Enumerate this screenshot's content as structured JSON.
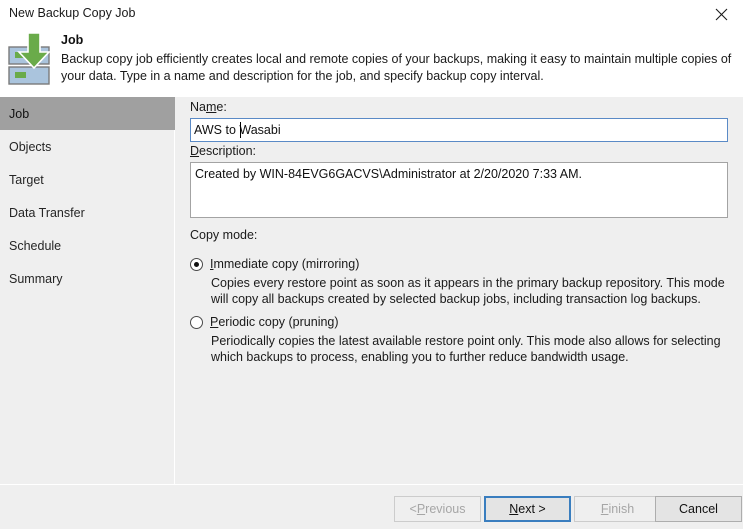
{
  "window": {
    "title": "New Backup Copy Job",
    "close_icon": "close-icon"
  },
  "header": {
    "icon": "backup-copy-job-icon",
    "title": "Job",
    "description": "Backup copy job efficiently creates local and remote copies of your backups, making it easy to maintain multiple copies of your data. Type in a name and description for the job, and specify backup copy interval."
  },
  "sidebar": {
    "items": [
      {
        "label": "Job",
        "selected": true
      },
      {
        "label": "Objects",
        "selected": false
      },
      {
        "label": "Target",
        "selected": false
      },
      {
        "label": "Data Transfer",
        "selected": false
      },
      {
        "label": "Schedule",
        "selected": false
      },
      {
        "label": "Summary",
        "selected": false
      }
    ]
  },
  "form": {
    "name_label_pre": "Na",
    "name_label_acc": "m",
    "name_label_post": "e:",
    "name_value": "AWS to Wasabi",
    "description_label_acc": "D",
    "description_label_post": "escription:",
    "description_value": "Created by WIN-84EVG6GACVS\\Administrator at 2/20/2020 7:33 AM.",
    "copy_mode_label": "Copy mode:",
    "copy_modes": [
      {
        "acc": "I",
        "label_rest": "mmediate copy (mirroring)",
        "selected": true,
        "description": "Copies every restore point as soon as it appears in the primary backup repository. This mode will copy all backups created by selected backup jobs, including transaction log backups."
      },
      {
        "acc": "P",
        "label_rest": "eriodic copy (pruning)",
        "selected": false,
        "description": "Periodically copies the latest available restore point only. This mode also allows for selecting which backups to process, enabling you to further reduce bandwidth usage."
      }
    ]
  },
  "footer": {
    "previous_pre": "< ",
    "previous_acc": "P",
    "previous_post": "revious",
    "next_acc": "N",
    "next_post": "ext >",
    "finish_acc": "F",
    "finish_post": "inish",
    "cancel_label": "Cancel"
  },
  "colors": {
    "accent_blue": "#3a7ebf",
    "field_focus_blue": "#5a8ac6",
    "sidebar_selected": "#a0a0a0",
    "panel_bg": "#efefef",
    "icon_green": "#6aab4a",
    "icon_blue": "#aac4dd"
  }
}
